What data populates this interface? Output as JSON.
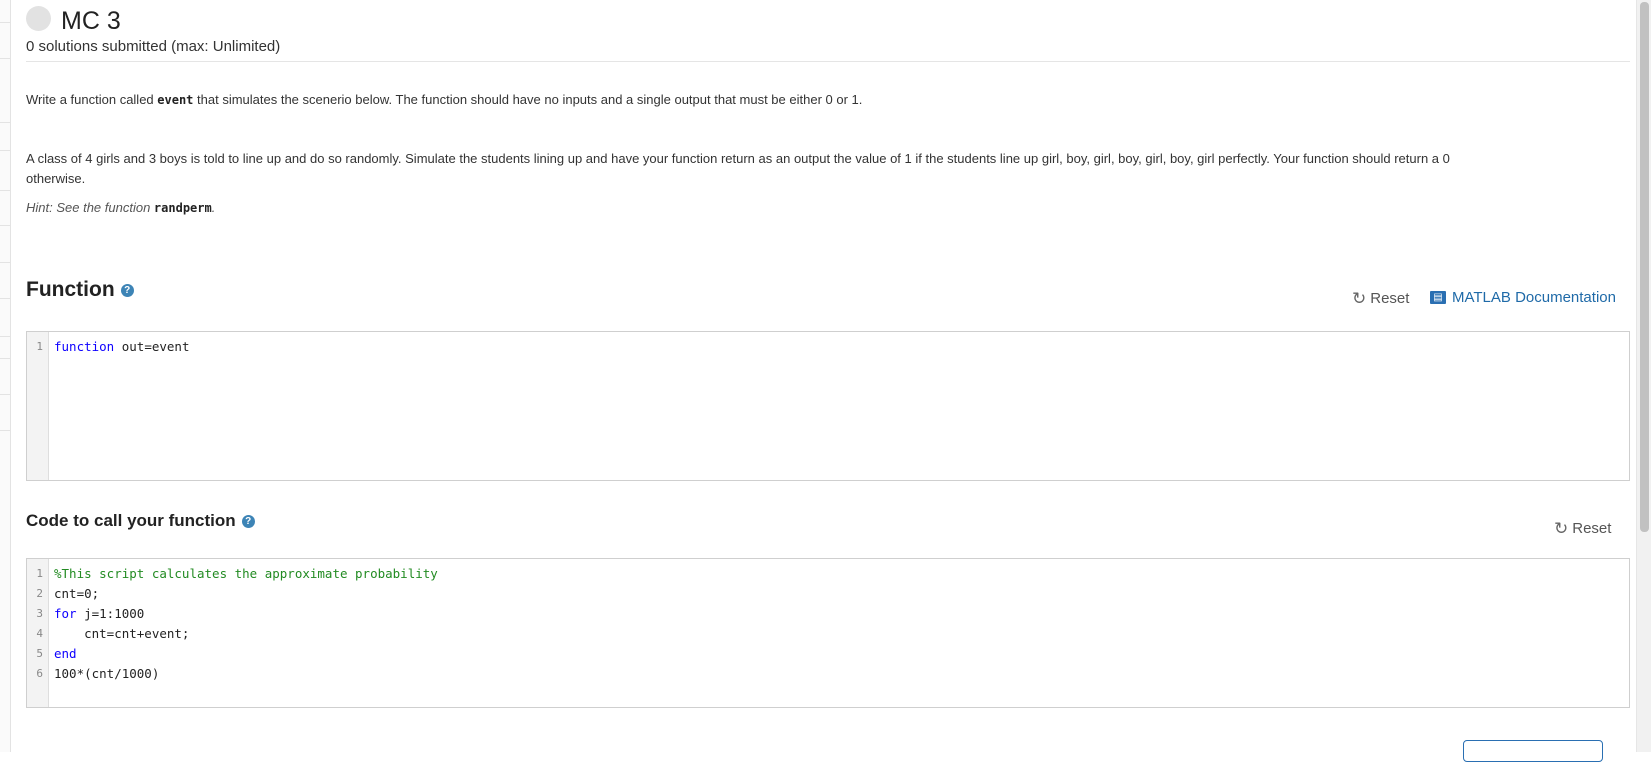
{
  "header": {
    "title": "MC 3",
    "submissions": "0 solutions submitted (max: Unlimited)"
  },
  "problem": {
    "p1_before": "Write a function called ",
    "p1_code": "event",
    "p1_after": " that simulates the scenerio below. The function should have no inputs and a single output that must be either 0 or 1.",
    "p2_line1": "A class of 4 girls and 3 boys is told to line up and do so randomly. Simulate the students lining up and have your function return as an output the value of 1 if the students line up girl, boy, girl, boy, girl, boy, girl perfectly.  Your function should return a 0",
    "p2_line2": "otherwise.",
    "hint_before": "Hint: See the function ",
    "hint_code": "randperm",
    "hint_after": "."
  },
  "function_section": {
    "title": "Function",
    "help_glyph": "?",
    "reset_label": "Reset",
    "doc_label": "MATLAB Documentation",
    "icons": {
      "help": "help-icon",
      "reset": "reset-icon",
      "doc": "book-icon"
    },
    "code": [
      {
        "num": "1",
        "keyword": "function",
        "rest": " out=event"
      }
    ]
  },
  "call_section": {
    "title": "Code to call your function",
    "help_glyph": "?",
    "reset_label": "Reset",
    "code": [
      {
        "num": "1",
        "comment": "%This script calculates the approximate probability"
      },
      {
        "num": "2",
        "text": "cnt=0;"
      },
      {
        "num": "3",
        "keyword": "for",
        "rest": " j=1:1000"
      },
      {
        "num": "4",
        "text": "    cnt=cnt+event;"
      },
      {
        "num": "5",
        "keyword": "end"
      },
      {
        "num": "6",
        "text": "100*(cnt/1000)"
      }
    ]
  },
  "colors": {
    "keyword": "#0e00ff",
    "comment": "#228b22",
    "link": "#1f6aa8",
    "help_icon": "#3d84b6"
  }
}
